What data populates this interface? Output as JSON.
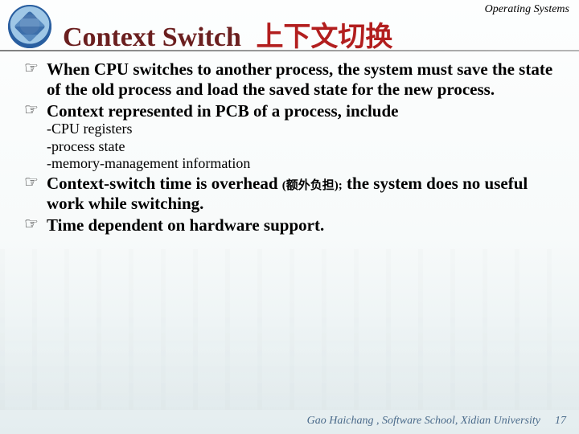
{
  "header": {
    "course": "Operating Systems"
  },
  "title": {
    "en": "Context Switch",
    "zh": "上下文切换"
  },
  "bullets": [
    "When CPU switches to another process, the system must save the state of the old process and load the saved state for the new process.",
    "Context represented in  PCB of a process, include"
  ],
  "sublist": [
    "-CPU registers",
    "-process state",
    "-memory-management information"
  ],
  "bullets2_pre": "Context-switch time is overhead ",
  "bullets2_paren": "(额外负担);",
  "bullets2_post": " the system does no useful work while switching.",
  "bullet3": "Time dependent on hardware support.",
  "footer": {
    "credit": "Gao Haichang ,  Software School,  Xidian University",
    "page": "17"
  }
}
